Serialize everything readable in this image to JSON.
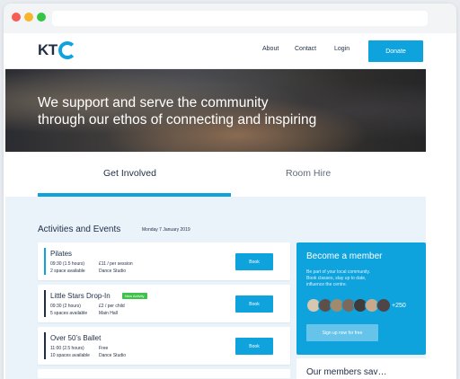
{
  "header": {
    "logo": "KT",
    "nav": [
      "About",
      "Contact",
      "Login"
    ],
    "donate_label": "Donate"
  },
  "hero": {
    "title_line1": "We support and serve the community",
    "title_line2": "through our ethos of connecting and inspiring"
  },
  "tabs": [
    {
      "label": "Get Involved",
      "active": true
    },
    {
      "label": "Room Hire",
      "active": false
    }
  ],
  "activities": {
    "heading": "Activities and Events",
    "date": "Monday 7 January 2019",
    "items": [
      {
        "title": "Pilates",
        "time": "09:30 (1.5 hours)",
        "price": "£11 / per session",
        "spaces": "2 space available",
        "location": "Dance Studio",
        "badge": "",
        "book": "Book"
      },
      {
        "title": "Little Stars Drop-In",
        "time": "09:30 (2 hours)",
        "price": "£2 / per child",
        "spaces": "5 spaces available",
        "location": "Main Hall",
        "badge": "New Activity",
        "book": "Book"
      },
      {
        "title": "Over 50’s Ballet",
        "time": "11:00 (2.5 hours)",
        "price": "Free",
        "spaces": "10 spaces available",
        "location": "Dance Studio",
        "badge": "",
        "book": "Book"
      }
    ]
  },
  "member": {
    "title": "Become a member",
    "desc": "Be part of your local community. Book classes, stay up to date, influence the centre.",
    "count": "+250",
    "signup": "Sign up now for free"
  },
  "testimonials": {
    "heading": "Our members sav…"
  },
  "colors": {
    "accent": "#0fa3de",
    "dark": "#1f2d45",
    "badge": "#3ec24a"
  }
}
